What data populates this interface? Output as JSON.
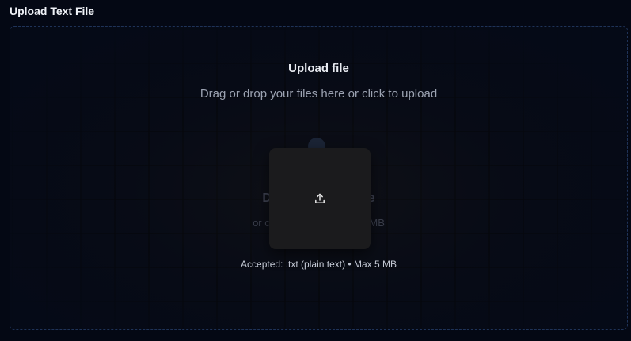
{
  "section": {
    "title": "Upload Text File"
  },
  "dropzone": {
    "heading": "Upload file",
    "subheading": "Drag or drop your files here or click to upload",
    "ghost_title": "Drop your file here",
    "ghost_subtitle": "or click to browse · Max 5MB",
    "accepted_note": "Accepted: .txt (plain text) • Max 5 MB",
    "upload_icon": "upload-icon"
  },
  "colors": {
    "background": "#040814",
    "dropzone_border": "#1f3358",
    "card": "#1b1b1d"
  }
}
